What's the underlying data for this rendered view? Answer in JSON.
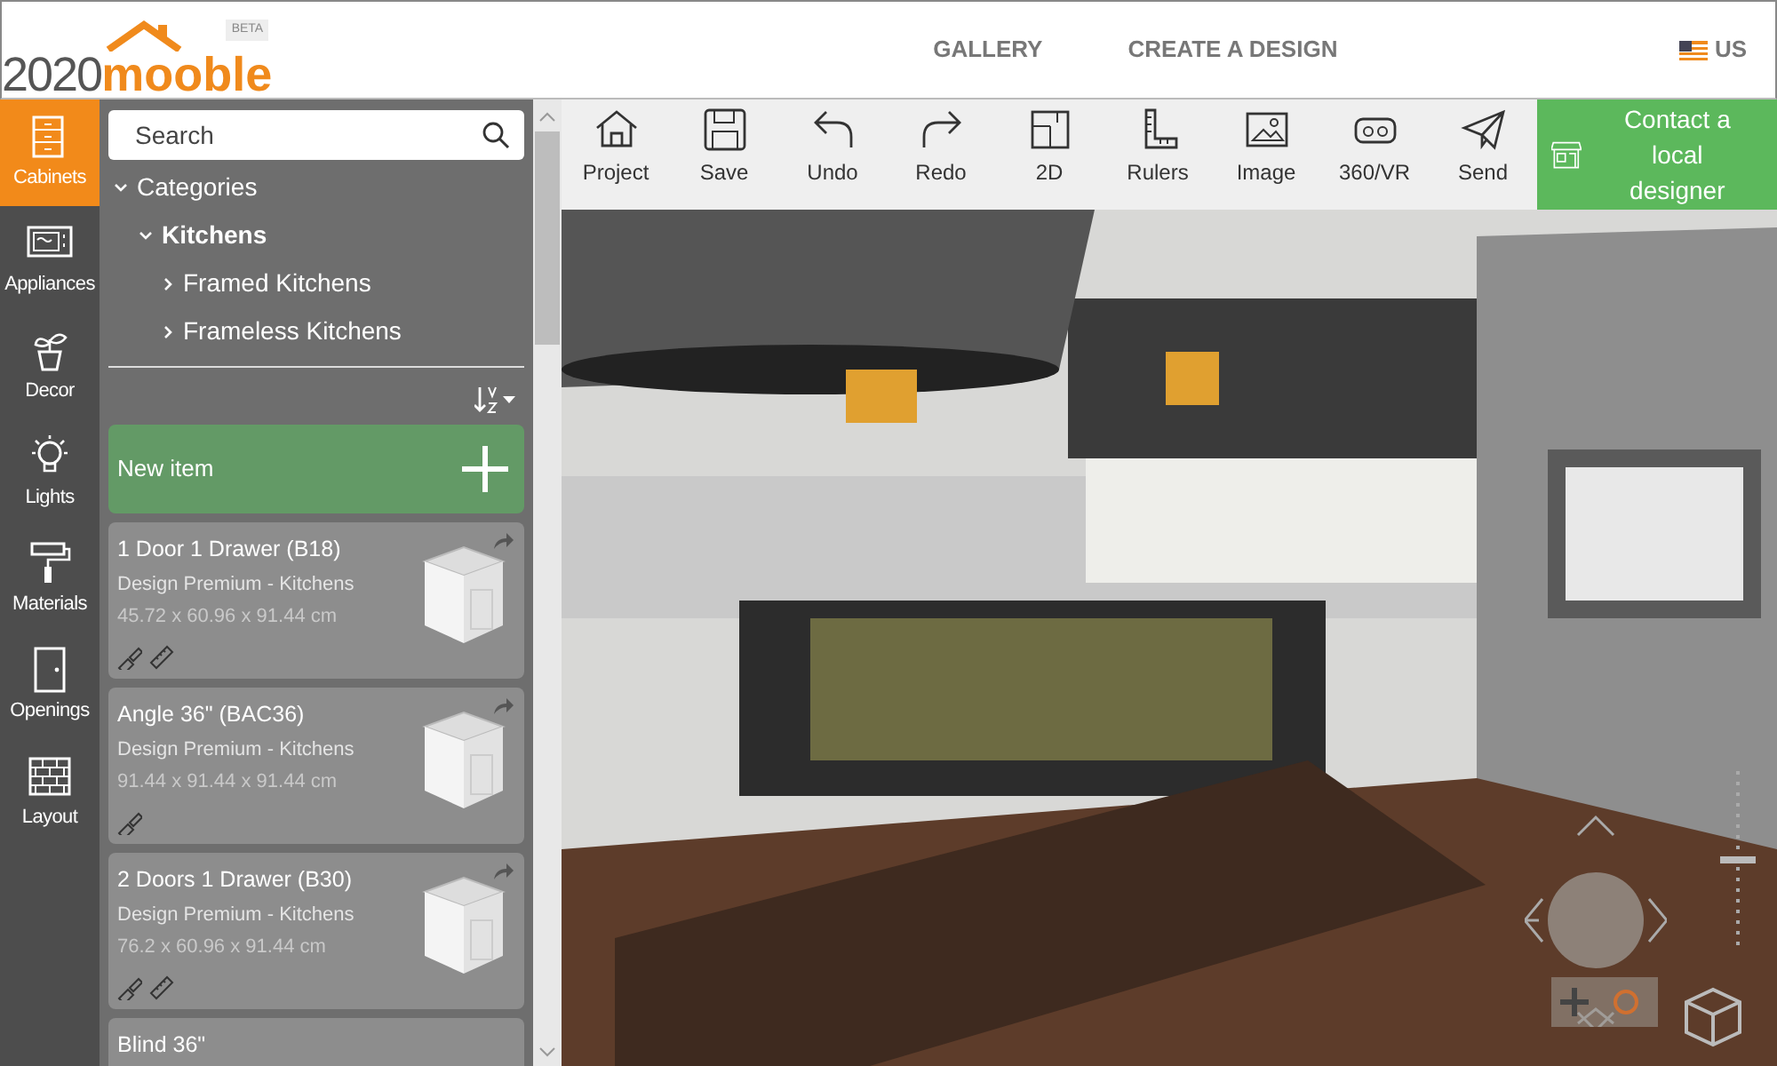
{
  "header": {
    "logo": {
      "digits": "2020",
      "brand": "mooble",
      "badge": "BETA"
    },
    "nav": [
      "GALLERY",
      "CREATE A DESIGN"
    ],
    "locale": "US"
  },
  "rail": [
    {
      "label": "Cabinets",
      "selected": true
    },
    {
      "label": "Appliances",
      "selected": false
    },
    {
      "label": "Decor",
      "selected": false
    },
    {
      "label": "Lights",
      "selected": false
    },
    {
      "label": "Materials",
      "selected": false
    },
    {
      "label": "Openings",
      "selected": false
    },
    {
      "label": "Layout",
      "selected": false
    }
  ],
  "panel": {
    "search": {
      "placeholder": "Search"
    },
    "tree": [
      {
        "label": "Categories",
        "expanded": true,
        "children": [
          {
            "label": "Kitchens",
            "expanded": true,
            "children": [
              {
                "label": "Framed Kitchens",
                "expanded": false
              },
              {
                "label": "Frameless Kitchens",
                "expanded": false
              }
            ]
          }
        ]
      }
    ],
    "new_item": "New item",
    "products": [
      {
        "name": "1 Door 1 Drawer (B18)",
        "collection": "Design Premium - Kitchens",
        "size": "45.72 x 60.96 x 91.44 cm",
        "resizable": true
      },
      {
        "name": "Angle 36\" (BAC36)",
        "collection": "Design Premium - Kitchens",
        "size": "91.44 x 91.44 x 91.44 cm",
        "resizable": false
      },
      {
        "name": "2 Doors 1 Drawer (B30)",
        "collection": "Design Premium - Kitchens",
        "size": "76.2 x 60.96 x 91.44 cm",
        "resizable": true
      },
      {
        "name": "Blind 36\""
      }
    ]
  },
  "toolbar": [
    "Project",
    "Save",
    "Undo",
    "Redo",
    "2D",
    "Rulers",
    "Image",
    "360/VR",
    "Send"
  ],
  "contact": "Contact a local designer",
  "viewport": {
    "kind": "picture",
    "zoom": {
      "level": 0.5
    }
  }
}
